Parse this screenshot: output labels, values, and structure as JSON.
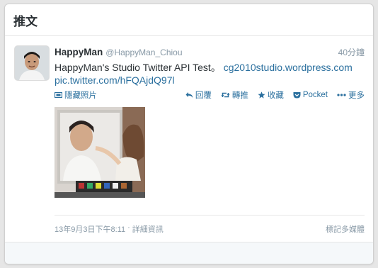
{
  "header": {
    "title": "推文"
  },
  "tweet": {
    "fullname": "HappyMan",
    "screen_name": "@HappyMan_Chiou",
    "time": "40分鐘",
    "text_main": "HappyMan's Studio Twitter API Test。",
    "link_1": "cg2010studio.wordpress.com",
    "link_2": "pic.twitter.com/hFQAjdQ97l",
    "actions": {
      "hide_photo": "隱藏照片",
      "reply": "回覆",
      "retweet": "轉推",
      "favorite": "收藏",
      "pocket": "Pocket",
      "more": "更多"
    },
    "timestamp": "13年9月3日下午8:11",
    "details_link": "詳細資訊",
    "separator": "·",
    "flag_media": "標記多媒體"
  },
  "colors": {
    "link": "#2a6f9e",
    "meta": "#8899a6",
    "text": "#292f33"
  },
  "icons": [
    "photo-icon",
    "reply-icon",
    "retweet-icon",
    "star-icon",
    "pocket-icon",
    "ellipsis-icon"
  ]
}
